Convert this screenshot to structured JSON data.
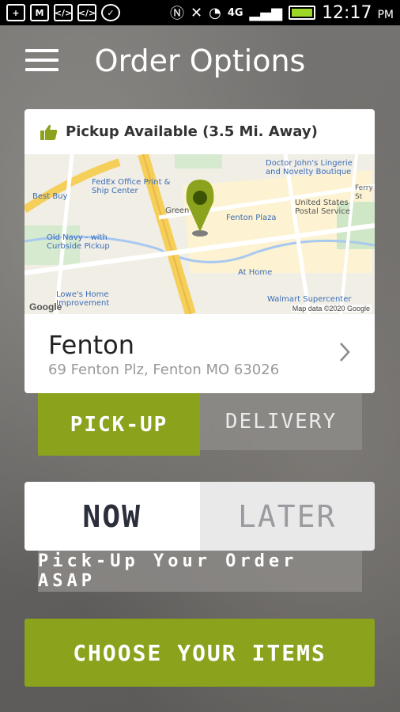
{
  "status_bar": {
    "time": "12:17",
    "ampm": "PM",
    "network": "4G"
  },
  "header": {
    "title": "Order Options"
  },
  "location_card": {
    "availability": "Pickup Available (3.5 Mi. Away)",
    "map": {
      "places": [
        "Doctor John's Lingerie and Novelty Boutique",
        "FedEx Office Print & Ship Center",
        "Best Buy",
        "Fenton Plaza",
        "United States Postal Service",
        "Old Navy - with Curbside Pickup",
        "At Home",
        "Lowe's Home Improvement",
        "Walmart Supercenter"
      ],
      "streets": [
        "Green",
        "Ferry St"
      ],
      "attribution": "Google",
      "map_data": "Map data ©2020 Google"
    },
    "store_name": "Fenton",
    "store_address": "69 Fenton Plz, Fenton MO 63026"
  },
  "order_type": {
    "pickup_label": "PICK-UP",
    "delivery_label": "DELIVERY",
    "selected": "pickup"
  },
  "order_time": {
    "now_label": "NOW",
    "later_label": "LATER",
    "selected": "now",
    "hint": "Pick-Up Your Order ASAP"
  },
  "actions": {
    "choose_label": "CHOOSE YOUR ITEMS"
  },
  "colors": {
    "accent": "#8aa21c",
    "pin": "#8aa21c",
    "map_road": "#f9d560",
    "map_water": "#a9c8f0"
  }
}
